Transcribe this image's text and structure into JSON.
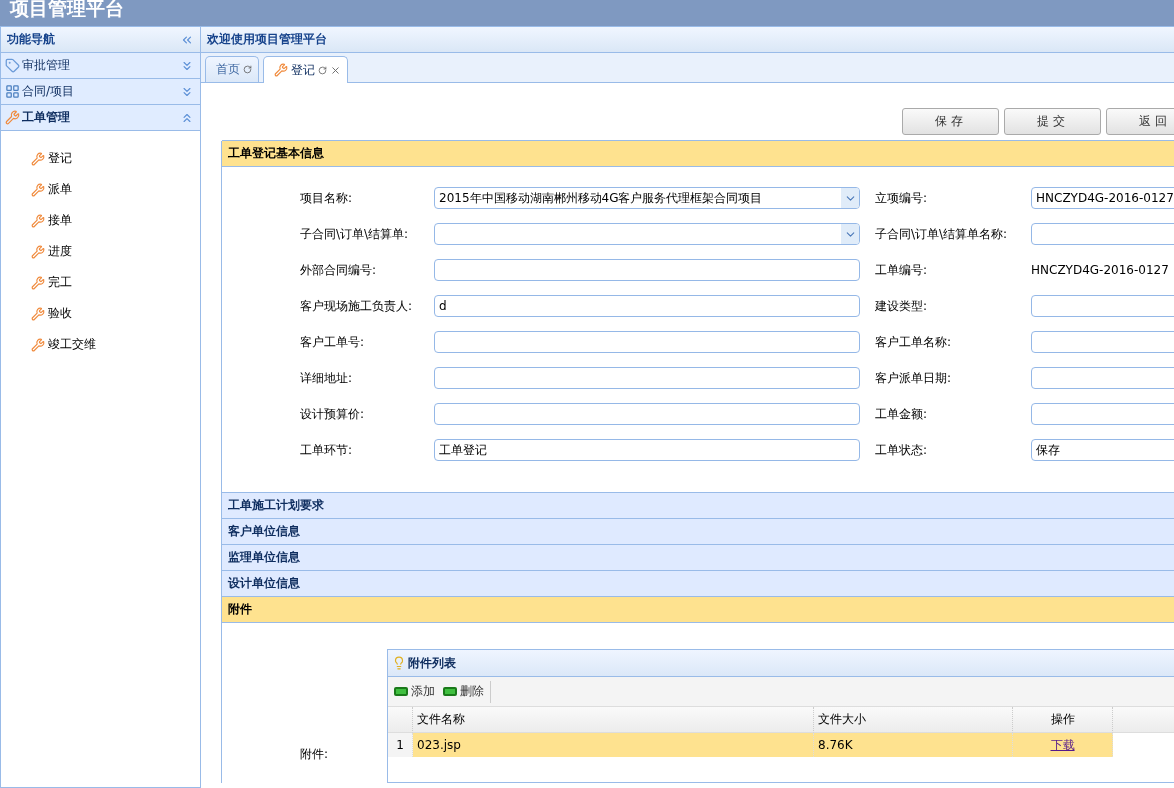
{
  "app_title": "项目管理平台",
  "sidebar": {
    "title": "功能导航",
    "groups": [
      {
        "label": "审批管理",
        "expanded": false
      },
      {
        "label": "合同/项目",
        "expanded": false
      },
      {
        "label": "工单管理",
        "expanded": true,
        "items": [
          "登记",
          "派单",
          "接单",
          "进度",
          "完工",
          "验收",
          "竣工交维"
        ]
      }
    ]
  },
  "main": {
    "title": "欢迎使用项目管理平台",
    "tabs": [
      {
        "label": "首页",
        "selected": false,
        "closable": false
      },
      {
        "label": "登记",
        "selected": true,
        "closable": true
      }
    ],
    "buttons": [
      "保存",
      "提交",
      "返回"
    ],
    "sections": [
      {
        "title": "工单登记基本信息",
        "expanded": true,
        "kind": "form"
      },
      {
        "title": "工单施工计划要求",
        "expanded": false
      },
      {
        "title": "客户单位信息",
        "expanded": false
      },
      {
        "title": "监理单位信息",
        "expanded": false
      },
      {
        "title": "设计单位信息",
        "expanded": false
      },
      {
        "title": "附件",
        "expanded": true,
        "kind": "attachments"
      }
    ],
    "form_rows": [
      [
        {
          "label": "项目名称:",
          "kind": "select",
          "value": "2015年中国移动湖南郴州移动4G客户服务代理框架合同项目"
        },
        {
          "label": "立项编号:",
          "kind": "input",
          "value": "HNCZYD4G-2016-0127"
        }
      ],
      [
        {
          "label": "子合同\\订单\\结算单:",
          "kind": "select"
        },
        {
          "label": "子合同\\订单\\结算单名称:",
          "kind": "input"
        }
      ],
      [
        {
          "label": "外部合同编号:",
          "kind": "input"
        },
        {
          "label": "工单编号:",
          "kind": "text",
          "value": "HNCZYD4G-2016-0127"
        }
      ],
      [
        {
          "label": "客户现场施工负责人:",
          "kind": "input",
          "value": "d"
        },
        {
          "label": "建设类型:",
          "kind": "input"
        }
      ],
      [
        {
          "label": "客户工单号:",
          "kind": "input"
        },
        {
          "label": "客户工单名称:",
          "kind": "input"
        }
      ],
      [
        {
          "label": "详细地址:",
          "kind": "input"
        },
        {
          "label": "客户派单日期:",
          "kind": "input"
        }
      ],
      [
        {
          "label": "设计预算价:",
          "kind": "input"
        },
        {
          "label": "工单金额:",
          "kind": "input"
        }
      ],
      [
        {
          "label": "工单环节:",
          "kind": "input",
          "value": "工单登记"
        },
        {
          "label": "工单状态:",
          "kind": "input",
          "value": "保存"
        }
      ]
    ],
    "attachments": {
      "label": "附件:",
      "title": "附件列表",
      "tools": [
        "添加",
        "删除"
      ],
      "columns": [
        "文件名称",
        "文件大小",
        "操作"
      ],
      "rows": [
        {
          "index": "1",
          "name": "023.jsp",
          "size": "8.76K",
          "action": "下载",
          "selected": true
        }
      ]
    }
  }
}
